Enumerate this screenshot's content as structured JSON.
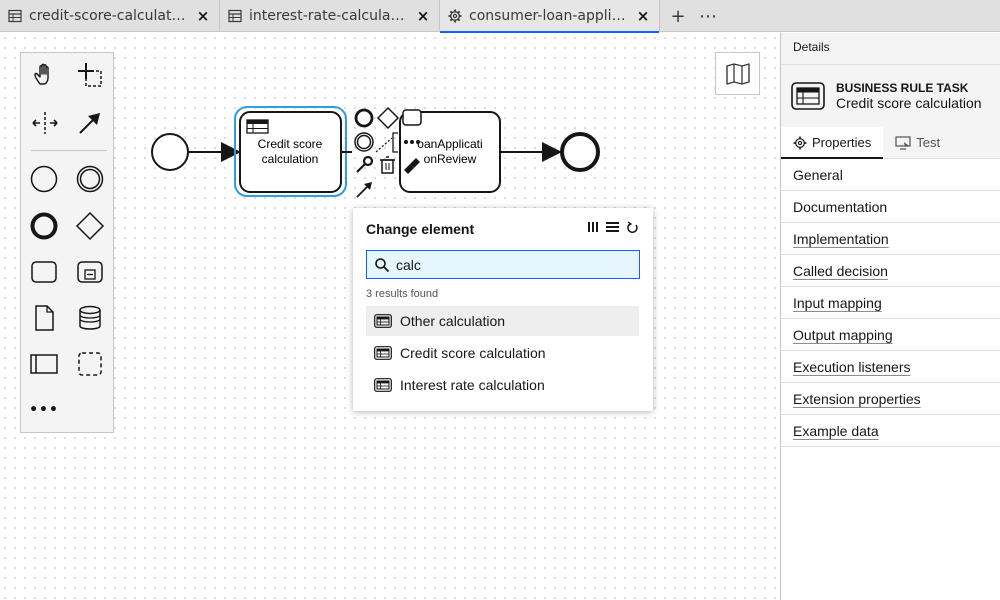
{
  "tabs": [
    {
      "label": "credit-score-calculation...",
      "icon": "table-icon",
      "close": "×"
    },
    {
      "label": "interest-rate-calculatio...",
      "icon": "table-icon",
      "close": "×"
    },
    {
      "label": "consumer-loan-applicat...",
      "icon": "gear-icon",
      "close": "×",
      "active": true
    }
  ],
  "tab_actions": {
    "add": "+",
    "more": "⋯"
  },
  "palette": {
    "items": [
      "hand-tool-icon",
      "lasso-tool-icon",
      "space-tool-icon",
      "global-connect-icon",
      "start-event-icon",
      "intermediate-event-icon",
      "end-event-icon",
      "gateway-icon",
      "task-icon",
      "subprocess-icon",
      "data-object-icon",
      "data-store-icon",
      "pool-icon",
      "group-icon",
      "more-icon"
    ],
    "more_label": "•••"
  },
  "diagram": {
    "task1": "Credit score\ncalculation",
    "task1_line1": "Credit score",
    "task1_line2": "calculation",
    "task2_line1": "oanApplicati",
    "task2_line2": "onReview"
  },
  "popup": {
    "title": "Change element",
    "search_value": "calc",
    "results_count": "3 results found",
    "results": [
      "Other calculation",
      "Credit score calculation",
      "Interest rate calculation"
    ]
  },
  "panel": {
    "header": "Details",
    "element_type": "BUSINESS RULE TASK",
    "element_name": "Credit score calculation",
    "tabs": [
      "Properties",
      "Test"
    ],
    "groups": [
      "General",
      "Documentation",
      "Implementation",
      "Called decision",
      "Input mapping",
      "Output mapping",
      "Execution listeners",
      "Extension properties",
      "Example data"
    ]
  },
  "colors": {
    "accent": "#0f62fe",
    "selection": "#2d9ee0"
  }
}
